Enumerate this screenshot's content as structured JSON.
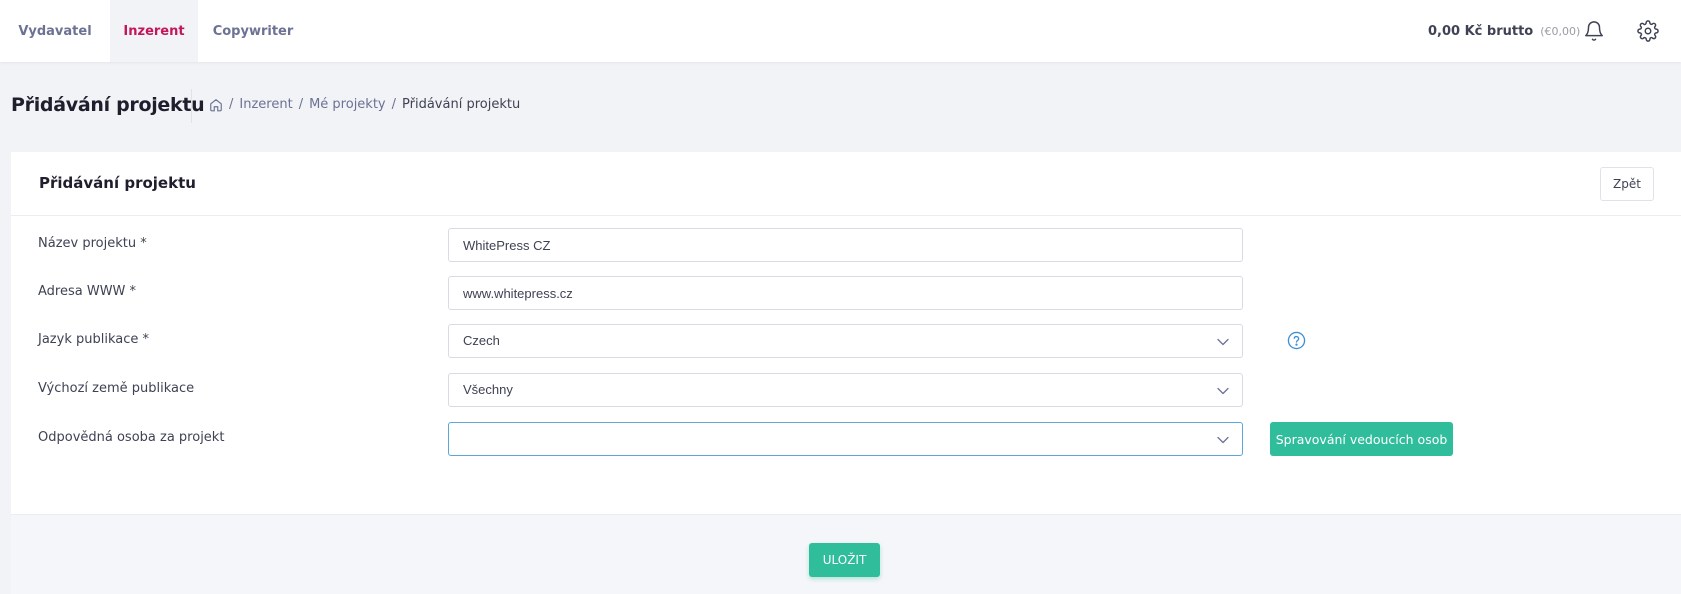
{
  "nav": {
    "tabs": [
      {
        "label": "Vydavatel",
        "active": false
      },
      {
        "label": "Inzerent",
        "active": true
      },
      {
        "label": "Copywriter",
        "active": false
      }
    ],
    "active_color": "#c2185b",
    "balance": "0,00 Kč brutto",
    "balance_eur": "(€0,00)",
    "icons": [
      "bell-icon",
      "gear-icon"
    ]
  },
  "subheader": {
    "title": "Přidávání projektu",
    "breadcrumb": {
      "home_icon": "home-icon",
      "items": [
        "Inzerent",
        "Mé projekty",
        "Přidávání projektu"
      ],
      "separator": "/"
    }
  },
  "card": {
    "title": "Přidávání projektu",
    "back_label": "Zpět",
    "fields": {
      "project_name": {
        "label": "Název projektu *",
        "value": "WhitePress CZ"
      },
      "website": {
        "label": "Adresa WWW *",
        "value": "www.whitepress.cz"
      },
      "language": {
        "label": "Jazyk publikace *",
        "value": "Czech",
        "help_icon": "question-circle-icon"
      },
      "country": {
        "label": "Výchozí země publikace",
        "value": "Všechny"
      },
      "responsible": {
        "label": "Odpovědná osoba za projekt",
        "value": "",
        "button_label": "Spravování vedoucích osob"
      }
    },
    "save_label": "ULOŽIT",
    "accent_color": "#2fbd9c"
  }
}
